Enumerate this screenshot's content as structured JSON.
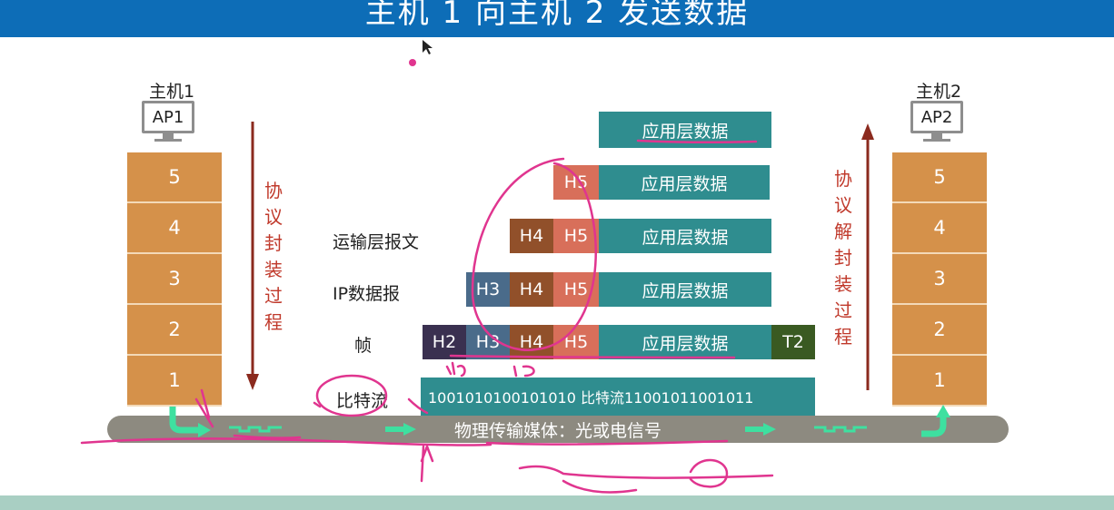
{
  "header": {
    "title": "主机 1 向主机 2 发送数据"
  },
  "host1": {
    "label": "主机1",
    "app": "AP1",
    "layers": [
      "5",
      "4",
      "3",
      "2",
      "1"
    ]
  },
  "host2": {
    "label": "主机2",
    "app": "AP2",
    "layers": [
      "5",
      "4",
      "3",
      "2",
      "1"
    ]
  },
  "encap_label": [
    "协",
    "议",
    "封",
    "装",
    "过",
    "程"
  ],
  "decap_label": [
    "协",
    "议",
    "解",
    "封",
    "装",
    "过",
    "程"
  ],
  "rows": {
    "app_data": "应用层数据",
    "h5": "H5",
    "h4": "H4",
    "h3": "H3",
    "h2": "H2",
    "t2": "T2",
    "transport_label": "运输层报文",
    "ip_label": "IP数据报",
    "frame_label": "帧",
    "bits_label": "比特流",
    "bits_text": "1001010100101010 比特流11001011001011"
  },
  "medium": {
    "label": "物理传输媒体：光或电信号"
  },
  "colors": {
    "header": "#0d6db7",
    "layer": "#d5914a",
    "app_data": "#2f8d8f",
    "h5": "#d86f5a",
    "h4": "#91502a",
    "h3": "#4a6b8a",
    "h2": "#3a3050",
    "t2": "#3a5a22",
    "medium": "#8d8a80",
    "arrow_down": "#8b2a1e",
    "annotation": "#e0358f",
    "signal": "#3ee0a0"
  }
}
